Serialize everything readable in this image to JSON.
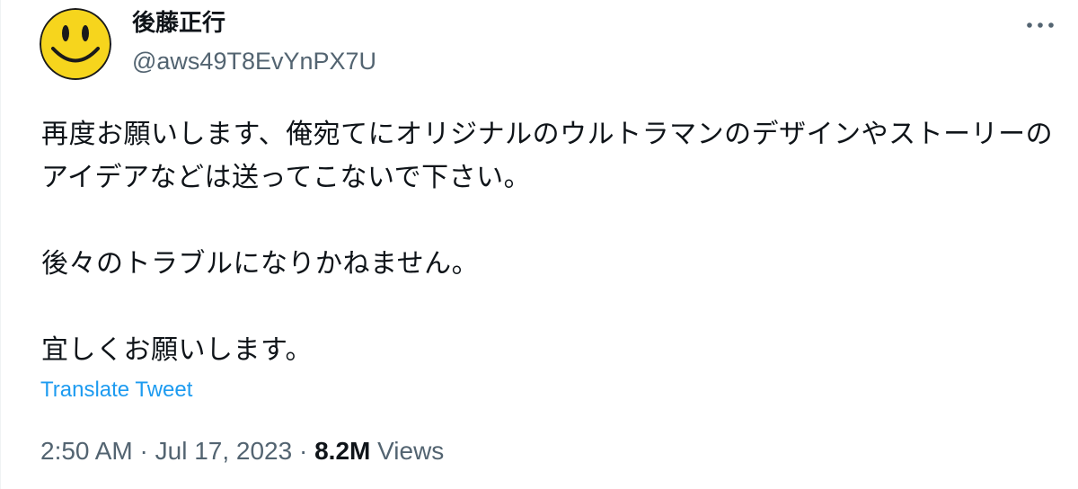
{
  "author": {
    "display_name": "後藤正行",
    "handle": "@aws49T8EvYnPX7U",
    "avatar_icon": "smiley-face-icon"
  },
  "menu": {
    "icon": "more-options-icon"
  },
  "tweet": {
    "paragraphs": [
      "再度お願いします、俺宛てにオリジナルのウルトラマンのデザインやストーリーのアイデアなどは送ってこないで下さい。",
      "後々のトラブルになりかねません。",
      "宜しくお願いします。"
    ],
    "translate_label": "Translate Tweet"
  },
  "meta": {
    "time": "2:50 AM",
    "separator": "·",
    "date": "Jul 17, 2023",
    "views_count": "8.2M",
    "views_label": "Views"
  },
  "colors": {
    "link": "#1d9bf0",
    "secondary_text": "#536471",
    "primary_text": "#0f1419",
    "avatar_yellow": "#f6d51d"
  }
}
